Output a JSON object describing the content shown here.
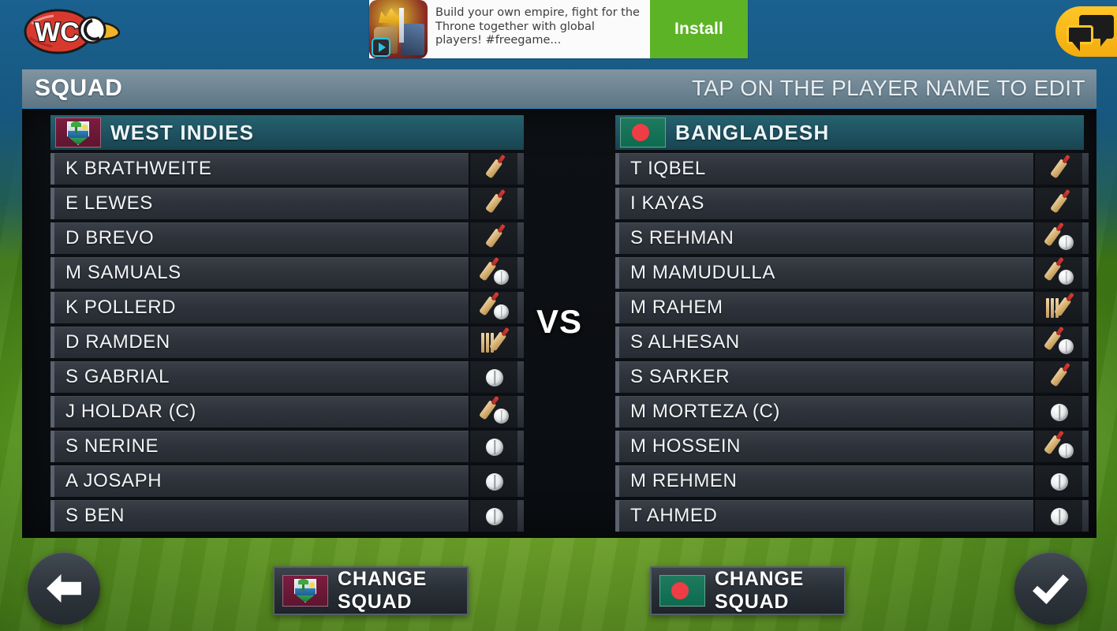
{
  "ad": {
    "icon": "game-app-icon",
    "text": "Build your own empire, fight for the Throne together with global players! #freegame...",
    "install_label": "Install"
  },
  "topbar": {
    "logo": "wcc-logo",
    "chat_icon": "chat-bubbles-icon"
  },
  "header": {
    "title": "SQUAD",
    "hint": "TAP ON THE PLAYER NAME TO EDIT"
  },
  "vs_label": "VS",
  "teams": [
    {
      "name": "WEST INDIES",
      "flag_icon": "west-indies-crest-icon",
      "players": [
        {
          "name": "K BRATHWEITE",
          "role": "batsman"
        },
        {
          "name": "E LEWES",
          "role": "batsman"
        },
        {
          "name": "D BREVO",
          "role": "batsman"
        },
        {
          "name": "M SAMUALS",
          "role": "allrounder"
        },
        {
          "name": "K POLLERD",
          "role": "allrounder"
        },
        {
          "name": "D RAMDEN",
          "role": "keeper"
        },
        {
          "name": "S GABRIAL",
          "role": "bowler"
        },
        {
          "name": "J HOLDAR (C)",
          "role": "allrounder"
        },
        {
          "name": "S NERINE",
          "role": "bowler"
        },
        {
          "name": "A JOSAPH",
          "role": "bowler"
        },
        {
          "name": "S BEN",
          "role": "bowler"
        }
      ],
      "change_squad_label": "CHANGE SQUAD"
    },
    {
      "name": "BANGLADESH",
      "flag_icon": "bangladesh-flag-icon",
      "players": [
        {
          "name": "T IQBEL",
          "role": "batsman"
        },
        {
          "name": "I KAYAS",
          "role": "batsman"
        },
        {
          "name": "S REHMAN",
          "role": "allrounder"
        },
        {
          "name": "M MAMUDULLA",
          "role": "allrounder"
        },
        {
          "name": "M RAHEM",
          "role": "keeper"
        },
        {
          "name": "S ALHESAN",
          "role": "allrounder"
        },
        {
          "name": "S SARKER",
          "role": "batsman"
        },
        {
          "name": "M MORTEZA (C)",
          "role": "bowler"
        },
        {
          "name": "M HOSSEIN",
          "role": "allrounder"
        },
        {
          "name": "M REHMEN",
          "role": "bowler"
        },
        {
          "name": "T AHMED",
          "role": "bowler"
        }
      ],
      "change_squad_label": "CHANGE SQUAD"
    }
  ],
  "controls": {
    "back_icon": "back-arrow-icon",
    "confirm_icon": "check-mark-icon"
  },
  "colors": {
    "accent_blue": "#2a83b8",
    "team_header_teal": "#1d4f5e",
    "install_green": "#5cb326",
    "chat_yellow": "#ffc627",
    "field_green": "#6aa527"
  }
}
